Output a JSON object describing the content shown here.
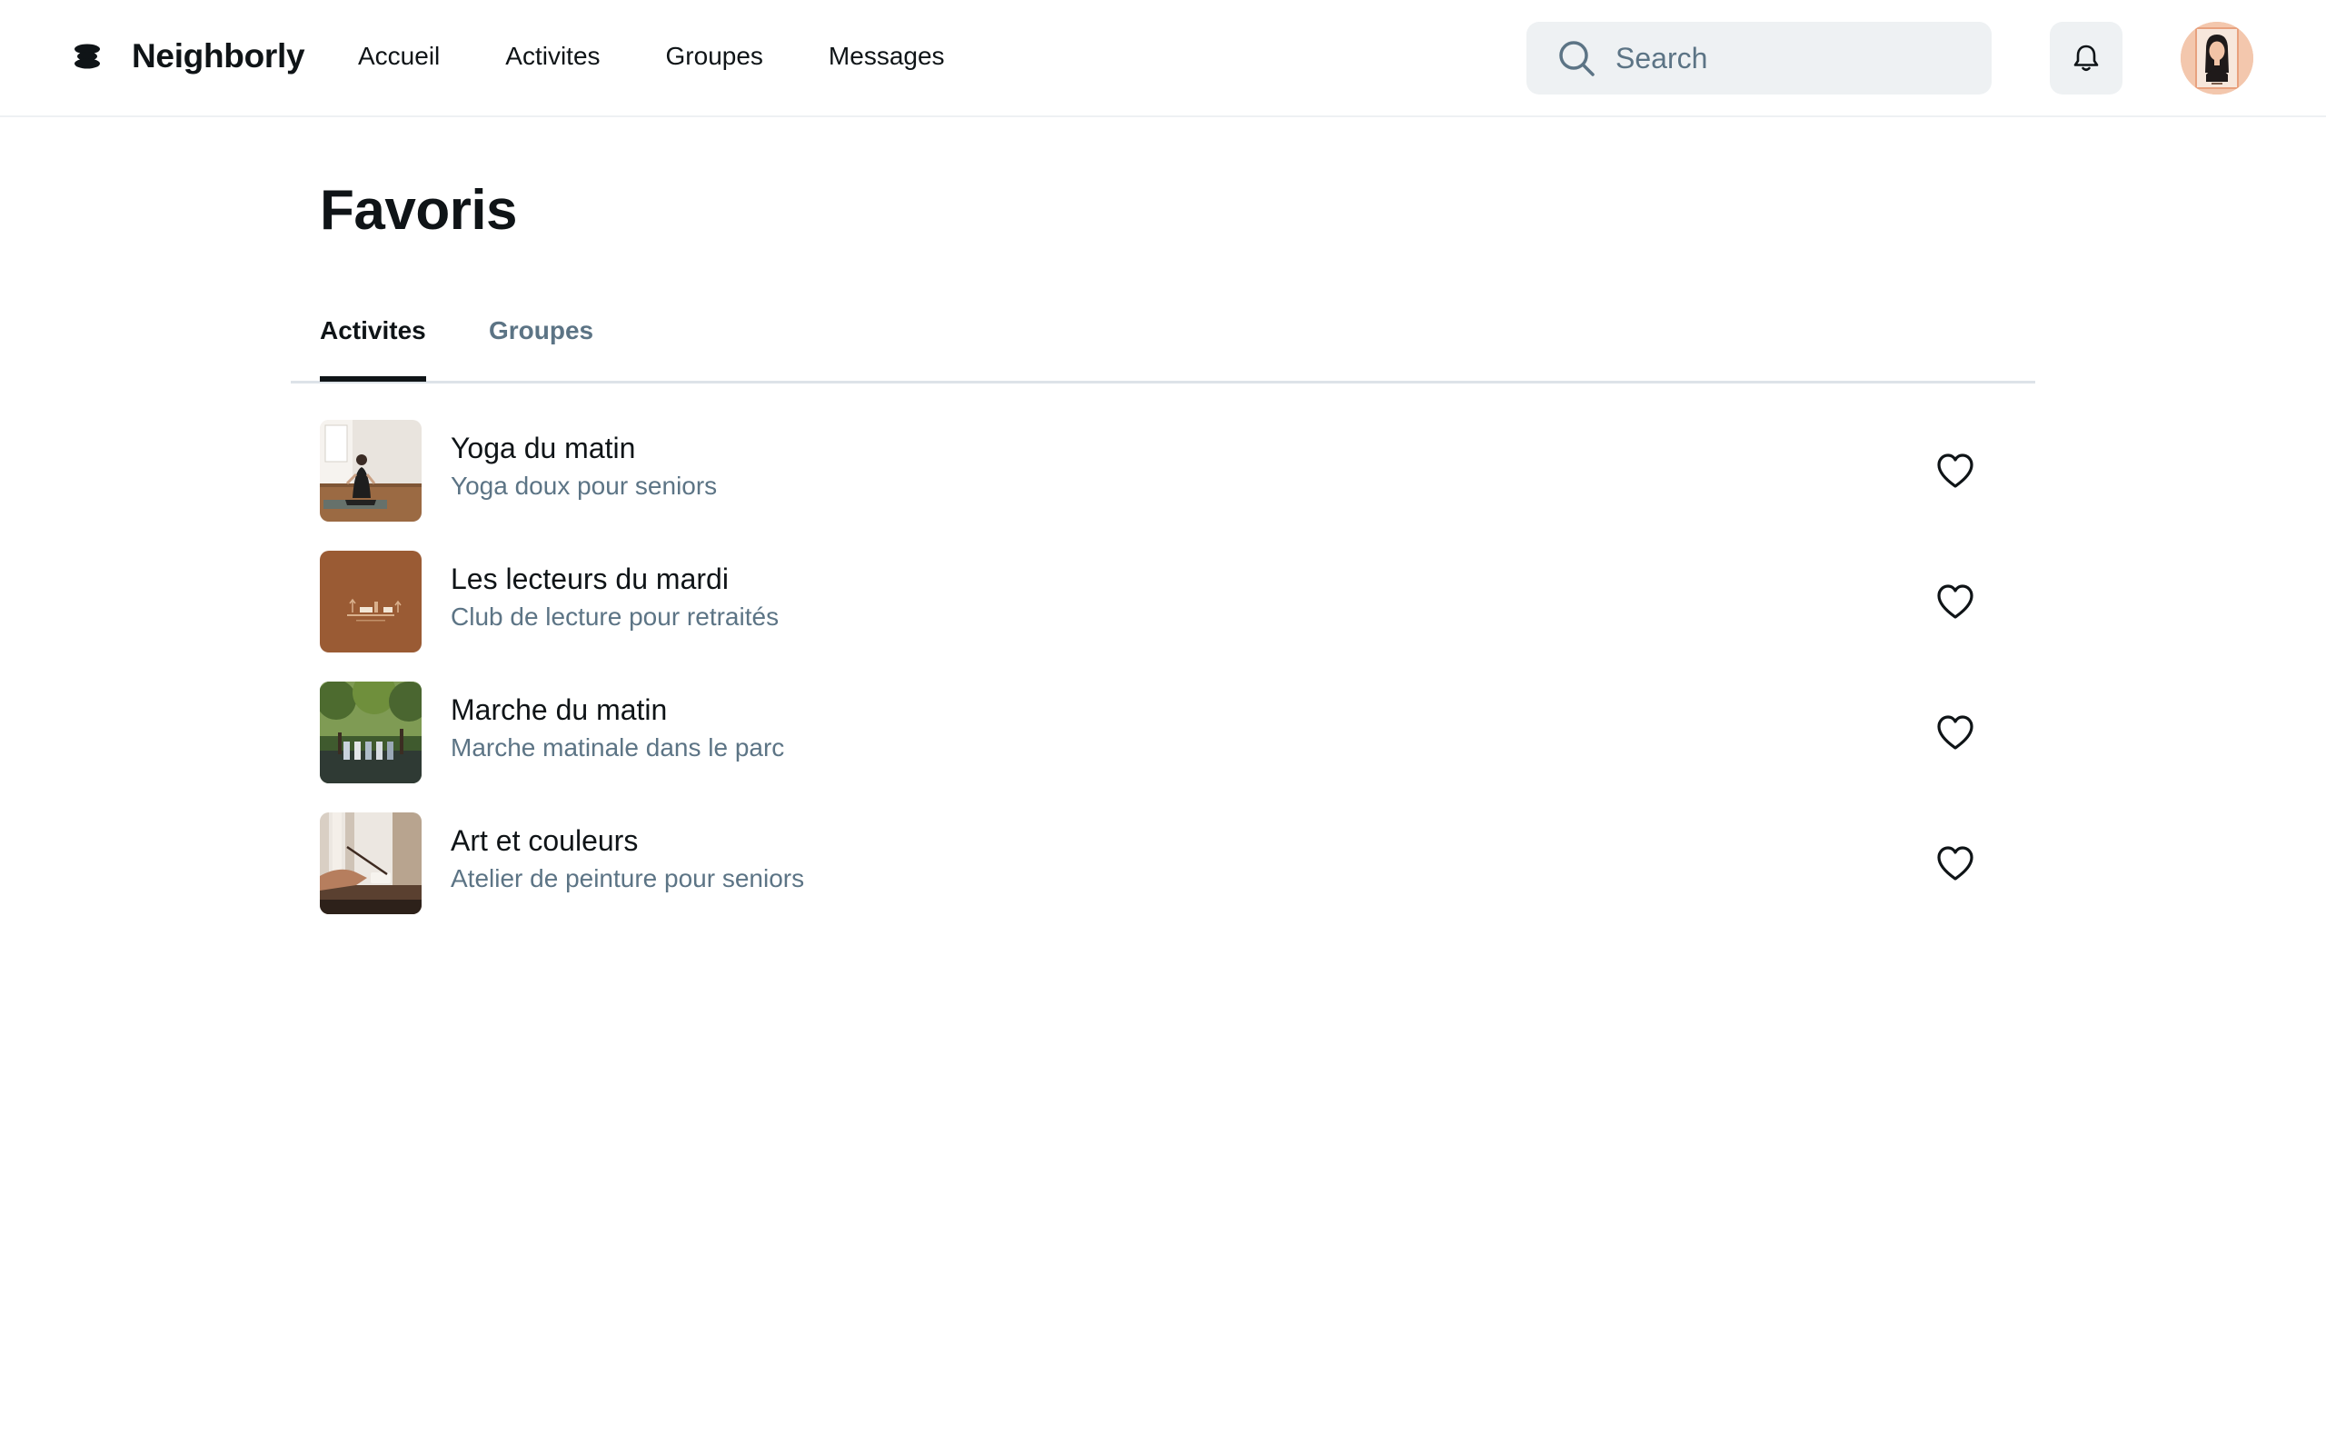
{
  "header": {
    "brand": "Neighborly",
    "nav": [
      "Accueil",
      "Activites",
      "Groupes",
      "Messages"
    ],
    "search_placeholder": "Search"
  },
  "page": {
    "title": "Favoris",
    "tabs": [
      "Activites",
      "Groupes"
    ],
    "active_tab": "Activites"
  },
  "favorites": [
    {
      "title": "Yoga du matin",
      "subtitle": "Yoga doux pour seniors",
      "thumb": "yoga-photo"
    },
    {
      "title": "Les lecteurs du mardi",
      "subtitle": "Club de lecture pour retraités",
      "thumb": "reading-illustration"
    },
    {
      "title": "Marche du matin",
      "subtitle": "Marche matinale dans le parc",
      "thumb": "park-walk-photo"
    },
    {
      "title": "Art et couleurs",
      "subtitle": "Atelier de peinture pour seniors",
      "thumb": "painting-photo"
    }
  ],
  "colors": {
    "text": "#0f1417",
    "muted": "#5c7485",
    "surface": "#eef1f3",
    "divider": "#dde3e8"
  },
  "icons": [
    "logo-icon",
    "search-icon",
    "bell-icon",
    "heart-icon"
  ]
}
